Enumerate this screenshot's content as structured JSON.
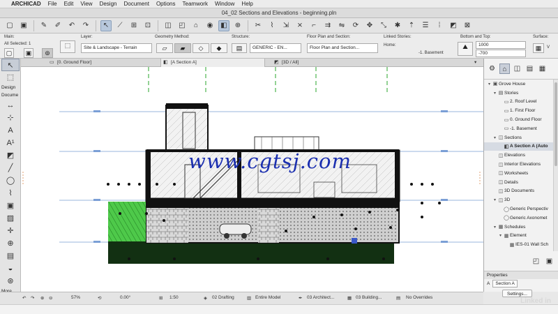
{
  "menubar": {
    "app_name": "ARCHICAD",
    "items": [
      "File",
      "Edit",
      "View",
      "Design",
      "Document",
      "Options",
      "Teamwork",
      "Window",
      "Help"
    ]
  },
  "window": {
    "title": "04_02 Sections and Elevations - beginning.pln"
  },
  "infobox": {
    "main_label": "Main:",
    "all_selected": "All Selected: 1",
    "layer_label": "Layer:",
    "layer_value": "Site & Landscape - Terrain",
    "geometry_label": "Geometry Method:",
    "structure_label": "Structure:",
    "structure_value": "GENERIC - EN...",
    "floorplan_label": "Floor Plan and Section:",
    "floorplan_value": "Floor Plan and Section...",
    "linked_label": "Linked Stories:",
    "home_label": "Home:",
    "home_value": "-1. Basement",
    "bottomtop_label": "Bottom and Top:",
    "top_value": "1000",
    "bottom_value": "-700",
    "surface_label": "Surface:",
    "surface_value": "V"
  },
  "tabs": [
    {
      "label": "[0. Ground Floor]",
      "icon": "floorplan-icon"
    },
    {
      "label": "[A Section A]",
      "icon": "section-icon"
    },
    {
      "label": "[3D / All]",
      "icon": "3d-icon"
    }
  ],
  "toolbox": {
    "design_label": "Design",
    "document_label": "Docume",
    "more_label": "More"
  },
  "watermark": "www.cgtsj.com",
  "navigator": {
    "rows": [
      {
        "label": "Grove House",
        "indent": 0,
        "twisty": "▾",
        "icon": "▣"
      },
      {
        "label": "Stories",
        "indent": 1,
        "twisty": "▾",
        "icon": "▤"
      },
      {
        "label": "2. Roof Level",
        "indent": 2,
        "twisty": "",
        "icon": "▭"
      },
      {
        "label": "1. First Floor",
        "indent": 2,
        "twisty": "",
        "icon": "▭"
      },
      {
        "label": "0. Ground Floor",
        "indent": 2,
        "twisty": "",
        "icon": "▭"
      },
      {
        "label": "-1. Basement",
        "indent": 2,
        "twisty": "",
        "icon": "▭"
      },
      {
        "label": "Sections",
        "indent": 1,
        "twisty": "▾",
        "icon": "◫"
      },
      {
        "label": "A Section A (Auto",
        "indent": 2,
        "twisty": "",
        "icon": "◧",
        "selected": true
      },
      {
        "label": "Elevations",
        "indent": 1,
        "twisty": "",
        "icon": "◫"
      },
      {
        "label": "Interior Elevations",
        "indent": 1,
        "twisty": "",
        "icon": "◫"
      },
      {
        "label": "Worksheets",
        "indent": 1,
        "twisty": "",
        "icon": "◫"
      },
      {
        "label": "Details",
        "indent": 1,
        "twisty": "",
        "icon": "◫"
      },
      {
        "label": "3D Documents",
        "indent": 1,
        "twisty": "",
        "icon": "◫"
      },
      {
        "label": "3D",
        "indent": 1,
        "twisty": "▾",
        "icon": "◫"
      },
      {
        "label": "Generic Perspectiv",
        "indent": 2,
        "twisty": "",
        "icon": "◯"
      },
      {
        "label": "Generic Axonomet",
        "indent": 2,
        "twisty": "",
        "icon": "◯"
      },
      {
        "label": "Schedules",
        "indent": 1,
        "twisty": "▾",
        "icon": "▦"
      },
      {
        "label": "Element",
        "indent": 2,
        "twisty": "▾",
        "icon": "▦"
      },
      {
        "label": "IES-01 Wall Sch",
        "indent": 3,
        "twisty": "",
        "icon": "▦"
      }
    ]
  },
  "properties": {
    "header": "Properties",
    "id": "A",
    "name": "Section A",
    "settings_label": "Settings..."
  },
  "statusbar": {
    "zoom": "57%",
    "angle": "0.00°",
    "scale": "1:50",
    "layer_combo": "02 Drafting",
    "model_view": "Entire Model",
    "pen_set": "03 Architect...",
    "mvo": "03 Building...",
    "overrides": "No Overrides"
  },
  "brand": "Linked in"
}
